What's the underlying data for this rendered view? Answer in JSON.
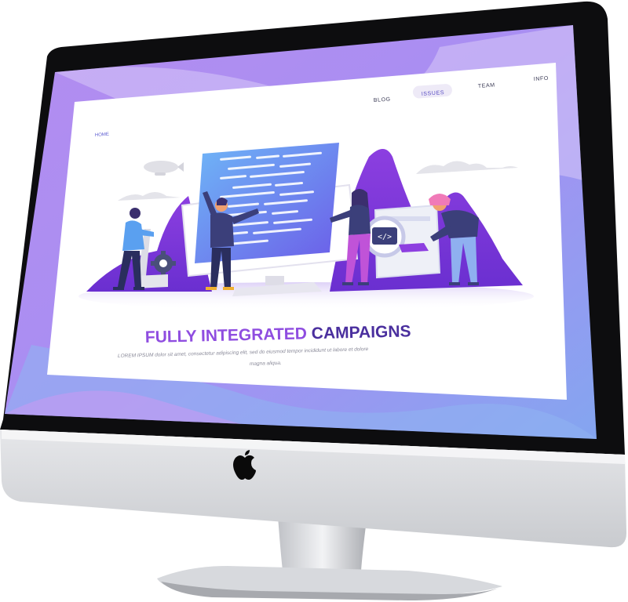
{
  "nav": {
    "items": [
      {
        "label": "BLOG"
      },
      {
        "label": "ISSUES",
        "active": true
      },
      {
        "label": "TEAM"
      },
      {
        "label": "INFO"
      }
    ]
  },
  "breadcrumb": {
    "home": "HOME"
  },
  "hero": {
    "title_highlight": "FULLY INTEGRATED",
    "title_rest": " CAMPAIGNS",
    "body_line1": "LOREM IPSUM dolor sit amet, consectetur adipiscing elit, sed do eiusmod tempor incididunt ut labore et dolore",
    "body_line2": "magna aliqua."
  },
  "icons": {
    "logo": "apple-logo-icon",
    "code": "code-brackets-icon",
    "magnifier": "magnifier-icon",
    "gear": "gear-icon",
    "blimp": "blimp-icon"
  },
  "colors": {
    "accent_purple": "#8f4de0",
    "title_dark": "#4a2f9e",
    "bezel": "#0d0d0f",
    "chin": "#dcdde0"
  }
}
